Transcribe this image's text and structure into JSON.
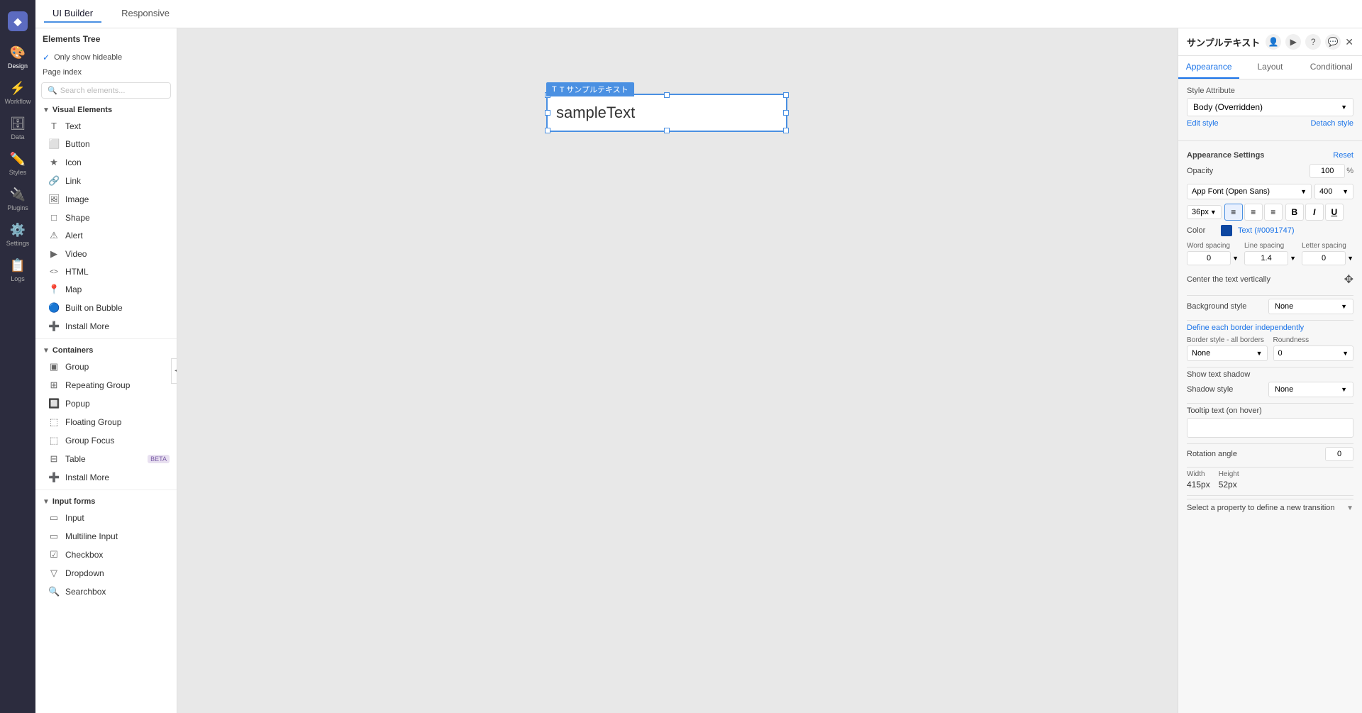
{
  "app": {
    "logo_icon": "◆",
    "left_nav": [
      {
        "id": "design",
        "icon": "🎨",
        "label": "Design",
        "active": true
      },
      {
        "id": "workflow",
        "icon": "⚡",
        "label": "Workflow",
        "active": false
      },
      {
        "id": "data",
        "icon": "🗄",
        "label": "Data",
        "active": false
      },
      {
        "id": "styles",
        "icon": "✏️",
        "label": "Styles",
        "active": false
      },
      {
        "id": "plugins",
        "icon": "🔌",
        "label": "Plugins",
        "active": false
      },
      {
        "id": "settings",
        "icon": "⚙️",
        "label": "Settings",
        "active": false
      },
      {
        "id": "logs",
        "icon": "📋",
        "label": "Logs",
        "active": false
      }
    ]
  },
  "topbar": {
    "tabs": [
      {
        "id": "ui-builder",
        "label": "UI Builder",
        "active": true
      },
      {
        "id": "responsive",
        "label": "Responsive",
        "active": false
      }
    ]
  },
  "sidebar": {
    "title": "Elements Tree",
    "only_show_hideable": "Only show hideable",
    "checkmark": "✓",
    "page_index_label": "Page index",
    "search_placeholder": "Search elements...",
    "visual_elements_label": "Visual Elements",
    "elements": [
      {
        "id": "text",
        "icon": "T",
        "label": "Text",
        "selected": false
      },
      {
        "id": "button",
        "icon": "⬜",
        "label": "Button",
        "selected": false
      },
      {
        "id": "icon",
        "icon": "★",
        "label": "Icon",
        "selected": false
      },
      {
        "id": "link",
        "icon": "🔗",
        "label": "Link",
        "selected": false
      },
      {
        "id": "image",
        "icon": "🖼",
        "label": "Image",
        "selected": false
      },
      {
        "id": "shape",
        "icon": "□",
        "label": "Shape",
        "selected": false
      },
      {
        "id": "alert",
        "icon": "⚠",
        "label": "Alert",
        "selected": false
      },
      {
        "id": "video",
        "icon": "▶",
        "label": "Video",
        "selected": false
      },
      {
        "id": "html",
        "icon": "<>",
        "label": "HTML",
        "selected": false
      },
      {
        "id": "map",
        "icon": "📍",
        "label": "Map",
        "selected": false
      },
      {
        "id": "built-on-bubble",
        "icon": "🔵",
        "label": "Built on Bubble",
        "selected": false
      },
      {
        "id": "install-more-1",
        "icon": "➕",
        "label": "Install More",
        "selected": false
      }
    ],
    "containers_label": "Containers",
    "containers": [
      {
        "id": "group",
        "icon": "▣",
        "label": "Group",
        "selected": false
      },
      {
        "id": "repeating-group",
        "icon": "⊞",
        "label": "Repeating Group",
        "selected": false
      },
      {
        "id": "popup",
        "icon": "🔲",
        "label": "Popup",
        "selected": false
      },
      {
        "id": "floating-group",
        "icon": "⬚",
        "label": "Floating Group",
        "selected": false
      },
      {
        "id": "group-focus",
        "icon": "⬚",
        "label": "Group Focus",
        "selected": false
      },
      {
        "id": "table",
        "icon": "⊟",
        "label": "Table",
        "badge": "BETA",
        "selected": false
      },
      {
        "id": "install-more-2",
        "icon": "➕",
        "label": "Install More",
        "selected": false
      }
    ],
    "input_forms_label": "Input forms",
    "inputs": [
      {
        "id": "input",
        "icon": "▭",
        "label": "Input",
        "selected": false
      },
      {
        "id": "multiline",
        "icon": "▭",
        "label": "Multiline Input",
        "selected": false
      },
      {
        "id": "checkbox",
        "icon": "☑",
        "label": "Checkbox",
        "selected": false
      },
      {
        "id": "dropdown",
        "icon": "▽",
        "label": "Dropdown",
        "selected": false
      },
      {
        "id": "searchbox",
        "icon": "🔍",
        "label": "Searchbox",
        "selected": false
      }
    ]
  },
  "canvas": {
    "element_label": "T サンプルテキスト",
    "element_text": "sampleText"
  },
  "right_panel": {
    "title": "サンプルテキスト",
    "header_icons": [
      "👤",
      "▶",
      "?",
      "💬"
    ],
    "tabs": [
      "Appearance",
      "Layout",
      "Conditional"
    ],
    "active_tab": "Appearance",
    "style_attribute": {
      "label": "Style Attribute",
      "value": "Body (Overridden)",
      "edit_style": "Edit style",
      "detach_style": "Detach style"
    },
    "appearance_settings": {
      "label": "Appearance Settings",
      "reset": "Reset"
    },
    "opacity": {
      "label": "Opacity",
      "value": "100",
      "unit": "%"
    },
    "font": {
      "family": "App Font (Open Sans)",
      "weight": "400"
    },
    "font_size": {
      "value": "36px"
    },
    "alignment": {
      "left": "≡",
      "center": "≡",
      "right": "≡",
      "active": "left"
    },
    "formatting": {
      "bold": "B",
      "italic": "I",
      "underline": "U"
    },
    "color": {
      "label": "Color",
      "swatch": "#0d47a1",
      "value": "Text (#0091747)"
    },
    "word_spacing": {
      "label": "Word spacing",
      "value": "0"
    },
    "line_spacing": {
      "label": "Line spacing",
      "value": "1.4"
    },
    "letter_spacing": {
      "label": "Letter spacing",
      "value": "0"
    },
    "center_text_vertically": "Center the text vertically",
    "background_style": {
      "label": "Background style",
      "value": "None"
    },
    "define_border": "Define each border independently",
    "border_style": {
      "label": "Border style - all borders",
      "value": "None"
    },
    "roundness": {
      "label": "Roundness",
      "value": "0"
    },
    "show_text_shadow": "Show text shadow",
    "shadow_style": {
      "label": "Shadow style",
      "value": "None"
    },
    "tooltip": {
      "label": "Tooltip text (on hover)"
    },
    "rotation": {
      "label": "Rotation angle",
      "value": "0"
    },
    "dimensions": {
      "width_label": "Width",
      "width_value": "415px",
      "height_label": "Height",
      "height_value": "52px"
    },
    "transition": "Select a property to define a new transition"
  }
}
